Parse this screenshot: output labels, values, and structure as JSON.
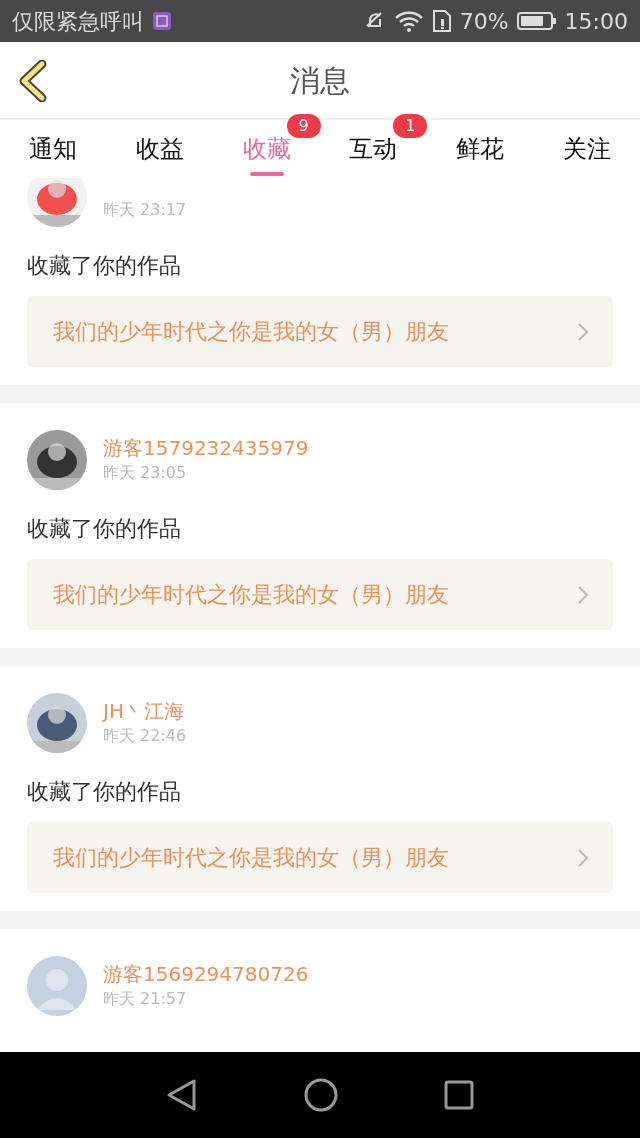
{
  "status_bar": {
    "carrier": "仅限紧急呼叫",
    "battery": "70%",
    "time": "15:00"
  },
  "header": {
    "title": "消息"
  },
  "tabs": [
    {
      "label": "通知",
      "selected": false
    },
    {
      "label": "收益",
      "selected": false
    },
    {
      "label": "收藏",
      "selected": true,
      "badge": "9"
    },
    {
      "label": "互动",
      "selected": false,
      "badge": "1"
    },
    {
      "label": "鲜花",
      "selected": false
    },
    {
      "label": "关注",
      "selected": false
    }
  ],
  "messages": [
    {
      "time": "昨天 23:17",
      "action": "收藏了你的作品",
      "work_title": "我们的少年时代之你是我的女（男）朋友"
    },
    {
      "name": "游客1579232435979",
      "time": "昨天 23:05",
      "action": "收藏了你的作品",
      "work_title": "我们的少年时代之你是我的女（男）朋友"
    },
    {
      "name": "JH丶江海",
      "time": "昨天 22:46",
      "action": "收藏了你的作品",
      "work_title": "我们的少年时代之你是我的女（男）朋友"
    },
    {
      "avatar": {
        "kind": "placeholder"
      },
      "name": "游客1569294780726",
      "time": "昨天 21:57"
    }
  ]
}
